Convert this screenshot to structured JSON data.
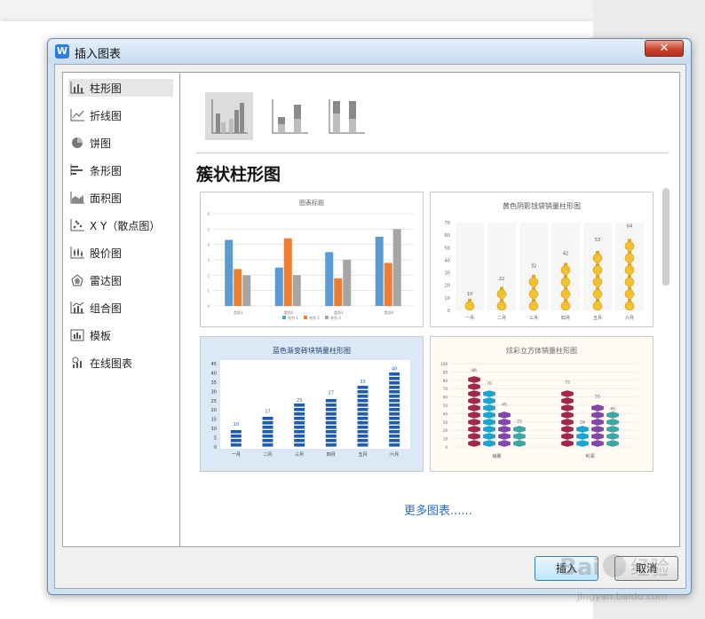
{
  "dialog": {
    "title": "插入图表",
    "app_icon_glyph": "W",
    "close_glyph": "✕"
  },
  "sidebar": {
    "items": [
      {
        "label": "柱形图",
        "icon": "column-chart-icon",
        "active": true
      },
      {
        "label": "折线图",
        "icon": "line-chart-icon"
      },
      {
        "label": "饼图",
        "icon": "pie-chart-icon"
      },
      {
        "label": "条形图",
        "icon": "bar-chart-icon"
      },
      {
        "label": "面积图",
        "icon": "area-chart-icon"
      },
      {
        "label": "X Y（散点图）",
        "icon": "scatter-chart-icon"
      },
      {
        "label": "股价图",
        "icon": "stock-chart-icon"
      },
      {
        "label": "雷达图",
        "icon": "radar-chart-icon"
      },
      {
        "label": "组合图",
        "icon": "combo-chart-icon"
      },
      {
        "label": "模板",
        "icon": "template-icon"
      },
      {
        "label": "在线图表",
        "icon": "online-chart-icon"
      }
    ]
  },
  "main": {
    "section_title": "簇状柱形图",
    "more_link": "更多图表......",
    "subtypes": [
      "clustered-column-icon",
      "stacked-column-icon",
      "percent-stacked-column-icon"
    ]
  },
  "buttons": {
    "insert": "插入",
    "cancel": "取消"
  },
  "watermark": {
    "text": "Baidu 经验",
    "url": "jingyan.baidu.com"
  },
  "colors": {
    "blue": "#5b9bd5",
    "orange": "#ed7d31",
    "gray": "#a5a5a5",
    "link": "#2f6db7"
  },
  "chart_data": [
    {
      "type": "bar",
      "title": "图表标题",
      "categories": [
        "类别1",
        "类别2",
        "类别3",
        "类别4"
      ],
      "series": [
        {
          "name": "系列 1",
          "values": [
            4.3,
            2.5,
            3.5,
            4.5
          ]
        },
        {
          "name": "系列 2",
          "values": [
            2.4,
            4.4,
            1.8,
            2.8
          ]
        },
        {
          "name": "系列 3",
          "values": [
            2.0,
            2.0,
            3.0,
            5.0
          ]
        }
      ],
      "yticks": [
        "0",
        "1",
        "2",
        "3",
        "4",
        "5",
        "6"
      ],
      "ylim": [
        0,
        6
      ]
    },
    {
      "type": "bar",
      "title": "黄色阴影钱袋销量柱形图",
      "categories": [
        "一月",
        "二月",
        "三月",
        "四月",
        "五月",
        "六月"
      ],
      "values": [
        10,
        22,
        32,
        42,
        53,
        64
      ],
      "yticks": [
        "0",
        "10",
        "20",
        "30",
        "40",
        "50",
        "60",
        "70"
      ],
      "ylim": [
        0,
        70
      ]
    },
    {
      "type": "bar",
      "title": "蓝色渐变砖块销量柱形图",
      "categories": [
        "一月",
        "二月",
        "三月",
        "四月",
        "五月",
        "六月"
      ],
      "values": [
        10,
        17,
        23,
        27,
        33,
        40
      ],
      "yticks": [
        "0",
        "5",
        "10",
        "15",
        "20",
        "25",
        "30",
        "35",
        "40",
        "45"
      ],
      "ylim": [
        0,
        45
      ]
    },
    {
      "type": "bar",
      "title": "炫彩立方体销量柱形图",
      "categories": [
        "销量",
        "利润"
      ],
      "series": [
        {
          "values": [
            86,
            72
          ]
        },
        {
          "values": [
            70,
            24
          ]
        },
        {
          "values": [
            45,
            55
          ]
        },
        {
          "values": [
            25,
            40
          ]
        }
      ],
      "yticks": [
        "0",
        "10",
        "20",
        "30",
        "40",
        "50",
        "60",
        "70",
        "80",
        "90",
        "100"
      ],
      "ylim": [
        0,
        100
      ]
    }
  ]
}
